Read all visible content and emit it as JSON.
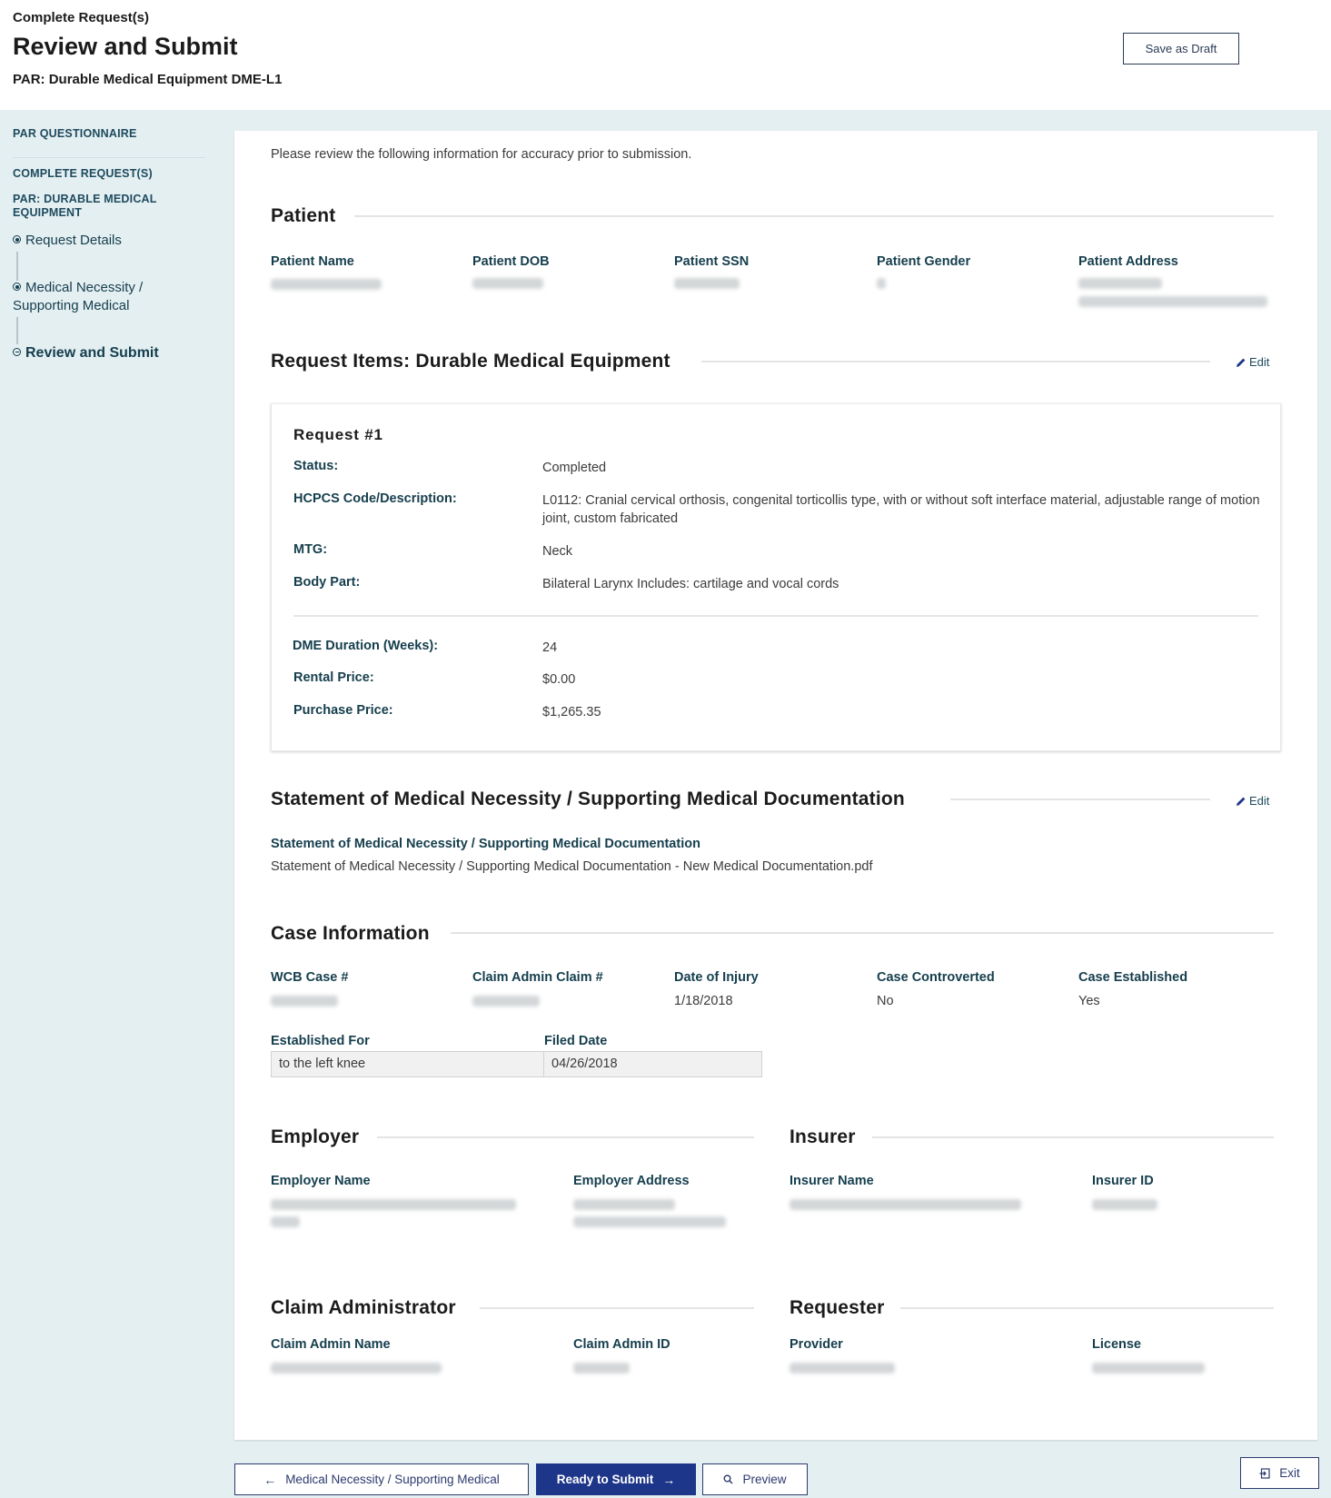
{
  "header": {
    "eyebrow": "Complete Request(s)",
    "title": "Review and Submit",
    "subtitle": "PAR: Durable Medical Equipment DME-L1",
    "save_draft_label": "Save as Draft"
  },
  "sidebar": {
    "links": [
      "PAR QUESTIONNAIRE",
      "COMPLETE REQUEST(S)",
      "PAR: DURABLE MEDICAL EQUIPMENT"
    ],
    "steps": [
      {
        "label": "Request Details",
        "state": "completed"
      },
      {
        "label": "Medical Necessity / Supporting Medical",
        "state": "completed"
      },
      {
        "label": "Review and Submit",
        "state": "current"
      }
    ]
  },
  "intro": "Please review the following information for accuracy prior to submission.",
  "edit_label": "Edit",
  "patient": {
    "title": "Patient",
    "fields": [
      {
        "label": "Patient Name",
        "value": "[redacted]"
      },
      {
        "label": "Patient DOB",
        "value": "[redacted]"
      },
      {
        "label": "Patient SSN",
        "value": "[redacted]"
      },
      {
        "label": "Patient Gender",
        "value": "[redacted]"
      },
      {
        "label": "Patient Address",
        "value": "[redacted]"
      }
    ]
  },
  "request_items": {
    "title": "Request Items: Durable Medical Equipment",
    "request": {
      "title": "Request #1",
      "rows": [
        {
          "label": "Status:",
          "value": "Completed"
        },
        {
          "label": "HCPCS Code/Description:",
          "value": "L0112: Cranial cervical orthosis, congenital torticollis type, with or without soft interface material, adjustable range of motion joint, custom fabricated"
        },
        {
          "label": "MTG:",
          "value": "Neck"
        },
        {
          "label": "Body Part:",
          "value": "Bilateral Larynx Includes: cartilage and vocal cords"
        }
      ],
      "pricing": [
        {
          "label": "DME Duration (Weeks):",
          "value": "24"
        },
        {
          "label": "Rental Price:",
          "value": "$0.00"
        },
        {
          "label": "Purchase Price:",
          "value": "$1,265.35"
        }
      ]
    }
  },
  "statement": {
    "title": "Statement of Medical Necessity / Supporting Medical Documentation",
    "label": "Statement of Medical Necessity / Supporting Medical Documentation",
    "value": "Statement of Medical Necessity / Supporting Medical Documentation - New Medical Documentation.pdf"
  },
  "case_info": {
    "title": "Case Information",
    "fields": [
      {
        "label": "WCB Case #",
        "value": "[redacted]"
      },
      {
        "label": "Claim Admin Claim #",
        "value": "[redacted]"
      },
      {
        "label": "Date of Injury",
        "value": "1/18/2018"
      },
      {
        "label": "Case Controverted",
        "value": "No"
      },
      {
        "label": "Case Established",
        "value": "Yes"
      }
    ],
    "table": {
      "headers": [
        "Established For",
        "Filed Date"
      ],
      "rows": [
        [
          "to the left knee",
          "04/26/2018"
        ]
      ]
    }
  },
  "employer": {
    "title": "Employer",
    "fields": [
      {
        "label": "Employer Name",
        "value": "[redacted]"
      },
      {
        "label": "Employer Address",
        "value": "[redacted]"
      }
    ]
  },
  "insurer": {
    "title": "Insurer",
    "fields": [
      {
        "label": "Insurer Name",
        "value": "[redacted]"
      },
      {
        "label": "Insurer ID",
        "value": "[redacted]"
      }
    ]
  },
  "claim_admin": {
    "title": "Claim Administrator",
    "fields": [
      {
        "label": "Claim Admin Name",
        "value": "[redacted]"
      },
      {
        "label": "Claim Admin ID",
        "value": "[redacted]"
      }
    ]
  },
  "requester": {
    "title": "Requester",
    "fields": [
      {
        "label": "Provider",
        "value": "[redacted]"
      },
      {
        "label": "License",
        "value": "[redacted]"
      }
    ]
  },
  "footer": {
    "back_label": "Medical Necessity / Supporting Medical",
    "submit_label": "Ready to Submit",
    "preview_label": "Preview",
    "exit_label": "Exit"
  },
  "colors": {
    "primary": "#1e3689",
    "label": "#153e4d",
    "background": "#e4eff2"
  }
}
